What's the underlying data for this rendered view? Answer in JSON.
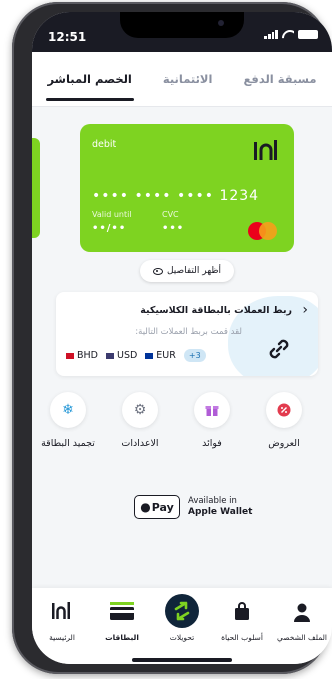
{
  "status_bar": {
    "time": "12:51"
  },
  "tabs": [
    {
      "label": "مسبقة الدفع",
      "active": false
    },
    {
      "label": "الائتمانية",
      "active": false
    },
    {
      "label": "الخصم المباشر",
      "active": true
    }
  ],
  "card": {
    "type": "debit",
    "number_masked": "•••• •••• •••• 1234",
    "valid_label": "Valid until",
    "valid_value": "••/••",
    "cvc_label": "CVC",
    "cvc_value": "•••",
    "color": "#7ed321"
  },
  "details_button": {
    "label": "أظهر التفاصيل"
  },
  "link_currencies": {
    "title": "ربط العملات بالبطاقة الكلاسيكية",
    "subtitle": "لقد قمت بربط العملات التالية:",
    "currencies": [
      "BHD",
      "USD",
      "EUR"
    ],
    "more": "+3"
  },
  "actions": [
    {
      "label": "العروض",
      "icon": "percent-badge-icon"
    },
    {
      "label": "فوائد",
      "icon": "gift-icon"
    },
    {
      "label": "الاعدادات",
      "icon": "gear-icon"
    },
    {
      "label": "تجميد البطاقة",
      "icon": "snowflake-icon"
    }
  ],
  "apple_wallet": {
    "badge": "Pay",
    "line1": "Available in",
    "line2": "Apple Wallet"
  },
  "bottom_nav": [
    {
      "label": "الملف الشخصي",
      "icon": "person-icon",
      "active": false
    },
    {
      "label": "أسلوب الحياة",
      "icon": "shopping-bag-icon",
      "active": false
    },
    {
      "label": "تحويلات",
      "icon": "transfer-arrows-icon",
      "active": false
    },
    {
      "label": "البطاقات",
      "icon": "card-icon",
      "active": true
    },
    {
      "label": "الرئيسية",
      "icon": "brand-logo-icon",
      "active": false
    }
  ],
  "colors": {
    "accent_green": "#7ed321",
    "dark": "#1a1b24"
  }
}
